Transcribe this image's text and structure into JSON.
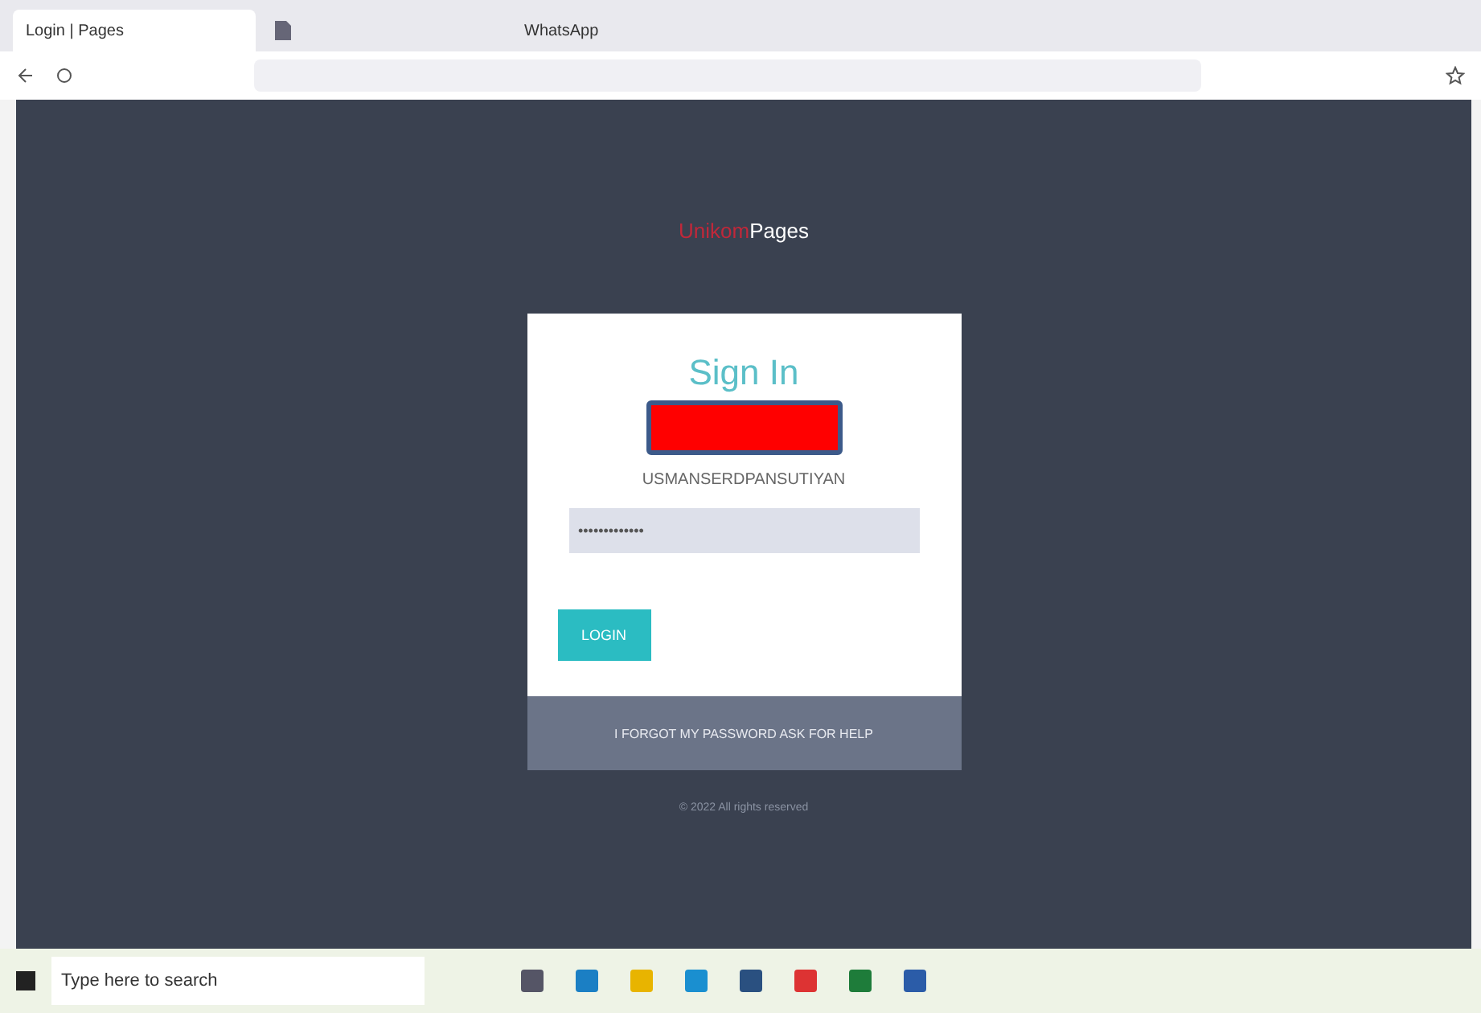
{
  "browser": {
    "tabs": [
      {
        "label": "Login | Pages",
        "selected": true
      },
      {
        "selected": false
      },
      {
        "label": "WhatsApp",
        "selected": false
      }
    ]
  },
  "logo": {
    "accent": "Unikom",
    "text": "Pages"
  },
  "login": {
    "title": "Sign In",
    "username": "USMANSERDPANSUTIYAN",
    "password": "•••••••••••••",
    "button": "LOGIN",
    "footer": "I FORGOT MY PASSWORD ASK FOR HELP"
  },
  "copyright": "© 2022 All rights reserved",
  "taskbar": {
    "search_placeholder": "Type here to search"
  }
}
